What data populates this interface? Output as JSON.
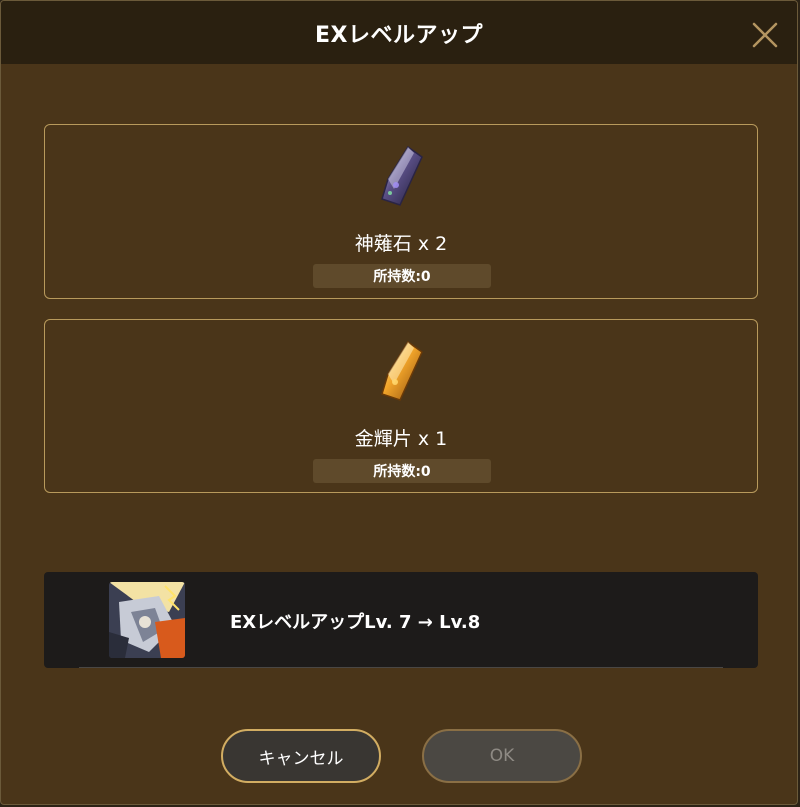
{
  "dialog": {
    "title": "EXレベルアップ"
  },
  "items": [
    {
      "name": "神薙石 x 2",
      "owned": "所持数:0",
      "icon": "dark-crystal-icon"
    },
    {
      "name": "金輝片 x 1",
      "owned": "所持数:0",
      "icon": "gold-crystal-icon"
    }
  ],
  "result": {
    "text": "EXレベルアップLv. 7 → Lv.8",
    "avatar": "character-portrait"
  },
  "buttons": {
    "cancel_label": "キャンセル",
    "ok_label": "OK"
  },
  "colors": {
    "dialog_bg": "#4a3519",
    "header_bg": "#2a2010",
    "card_border": "#b89a5c",
    "cancel_border": "#d2ad62",
    "ok_disabled_text": "#8e8a84"
  }
}
